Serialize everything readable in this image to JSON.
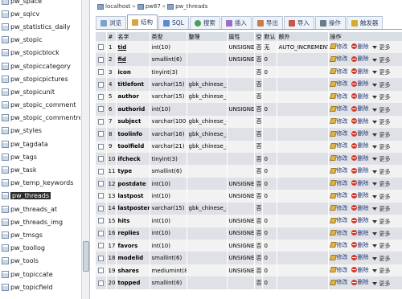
{
  "nav": {
    "items": [
      "pw_space",
      "pw_sqlcv",
      "pw_statistics_daily",
      "pw_stopic",
      "pw_stopicblock",
      "pw_stopiccategory",
      "pw_stopicpictures",
      "pw_stopicunit",
      "pw_stopic_comment",
      "pw_stopic_commentre",
      "pw_styles",
      "pw_tagdata",
      "pw_tags",
      "pw_task",
      "pw_temp_keywords",
      "pw_threads",
      "pw_threads_at",
      "pw_threads_img",
      "pw_tmsgs",
      "pw_toollog",
      "pw_tools",
      "pw_topiccate",
      "pw_topicfield"
    ],
    "selected_index": 15
  },
  "breadcrumb": {
    "server": "localhost",
    "database": "pw87",
    "table": "pw_threads"
  },
  "tabs": [
    {
      "id": "browse",
      "label": "浏览"
    },
    {
      "id": "structure",
      "label": "结构"
    },
    {
      "id": "sql",
      "label": "SQL"
    },
    {
      "id": "search",
      "label": "搜索"
    },
    {
      "id": "insert",
      "label": "插入"
    },
    {
      "id": "export",
      "label": "导出"
    },
    {
      "id": "import",
      "label": "导入"
    },
    {
      "id": "operations",
      "label": "操作"
    },
    {
      "id": "triggers",
      "label": "触发器"
    }
  ],
  "active_tab": "structure",
  "table": {
    "headers": {
      "num": "#",
      "name": "名字",
      "type": "类型",
      "collation": "整理",
      "attributes": "属性",
      "null": "空",
      "default": "默认",
      "extra": "额外",
      "action": "操作"
    },
    "action_labels": {
      "edit": "修改",
      "delete": "删除",
      "more": "更多"
    },
    "rows": [
      {
        "num": "1",
        "name": "tid",
        "type": "int(10)",
        "collation": "",
        "attributes": "UNSIGNED",
        "null": "否",
        "default": "无",
        "extra": "AUTO_INCREMENT",
        "underline": true
      },
      {
        "num": "2",
        "name": "fid",
        "type": "smallint(6)",
        "collation": "",
        "attributes": "UNSIGNED",
        "null": "否",
        "default": "0",
        "extra": "",
        "underline": true
      },
      {
        "num": "3",
        "name": "icon",
        "type": "tinyint(3)",
        "collation": "",
        "attributes": "",
        "null": "否",
        "default": "0",
        "extra": ""
      },
      {
        "num": "4",
        "name": "titlefont",
        "type": "varchar(15)",
        "collation": "gbk_chinese_ci",
        "attributes": "",
        "null": "否",
        "default": "",
        "extra": ""
      },
      {
        "num": "5",
        "name": "author",
        "type": "varchar(15)",
        "collation": "gbk_chinese_ci",
        "attributes": "",
        "null": "否",
        "default": "",
        "extra": ""
      },
      {
        "num": "6",
        "name": "authorid",
        "type": "int(10)",
        "collation": "",
        "attributes": "UNSIGNED",
        "null": "否",
        "default": "0",
        "extra": ""
      },
      {
        "num": "7",
        "name": "subject",
        "type": "varchar(100)",
        "collation": "gbk_chinese_ci",
        "attributes": "",
        "null": "否",
        "default": "",
        "extra": ""
      },
      {
        "num": "8",
        "name": "toolinfo",
        "type": "varchar(16)",
        "collation": "gbk_chinese_ci",
        "attributes": "",
        "null": "否",
        "default": "",
        "extra": ""
      },
      {
        "num": "9",
        "name": "toolfield",
        "type": "varchar(21)",
        "collation": "gbk_chinese_ci",
        "attributes": "",
        "null": "否",
        "default": "",
        "extra": ""
      },
      {
        "num": "10",
        "name": "ifcheck",
        "type": "tinyint(3)",
        "collation": "",
        "attributes": "",
        "null": "否",
        "default": "0",
        "extra": ""
      },
      {
        "num": "11",
        "name": "type",
        "type": "smallint(6)",
        "collation": "",
        "attributes": "",
        "null": "否",
        "default": "0",
        "extra": ""
      },
      {
        "num": "12",
        "name": "postdate",
        "type": "int(10)",
        "collation": "",
        "attributes": "UNSIGNED",
        "null": "否",
        "default": "0",
        "extra": ""
      },
      {
        "num": "13",
        "name": "lastpost",
        "type": "int(10)",
        "collation": "",
        "attributes": "UNSIGNED",
        "null": "否",
        "default": "0",
        "extra": ""
      },
      {
        "num": "14",
        "name": "lastposter",
        "type": "varchar(15)",
        "collation": "gbk_chinese_ci",
        "attributes": "",
        "null": "否",
        "default": "",
        "extra": ""
      },
      {
        "num": "15",
        "name": "hits",
        "type": "int(10)",
        "collation": "",
        "attributes": "UNSIGNED",
        "null": "否",
        "default": "0",
        "extra": ""
      },
      {
        "num": "16",
        "name": "replies",
        "type": "int(10)",
        "collation": "",
        "attributes": "UNSIGNED",
        "null": "否",
        "default": "0",
        "extra": ""
      },
      {
        "num": "17",
        "name": "favors",
        "type": "int(10)",
        "collation": "",
        "attributes": "UNSIGNED",
        "null": "否",
        "default": "0",
        "extra": ""
      },
      {
        "num": "18",
        "name": "modelid",
        "type": "smallint(6)",
        "collation": "",
        "attributes": "UNSIGNED",
        "null": "否",
        "default": "0",
        "extra": ""
      },
      {
        "num": "19",
        "name": "shares",
        "type": "mediumint(8)",
        "collation": "",
        "attributes": "UNSIGNED",
        "null": "否",
        "default": "0",
        "extra": ""
      },
      {
        "num": "20",
        "name": "topped",
        "type": "smallint(6)",
        "collation": "",
        "attributes": "",
        "null": "否",
        "default": "0",
        "extra": ""
      }
    ]
  },
  "colors": {
    "row_odd": "#f2f2f2",
    "row_even": "#dfe1e6",
    "header_bg": "#d9dde4",
    "link": "#1e3a7a",
    "delete_icon": "#d23a2f"
  }
}
